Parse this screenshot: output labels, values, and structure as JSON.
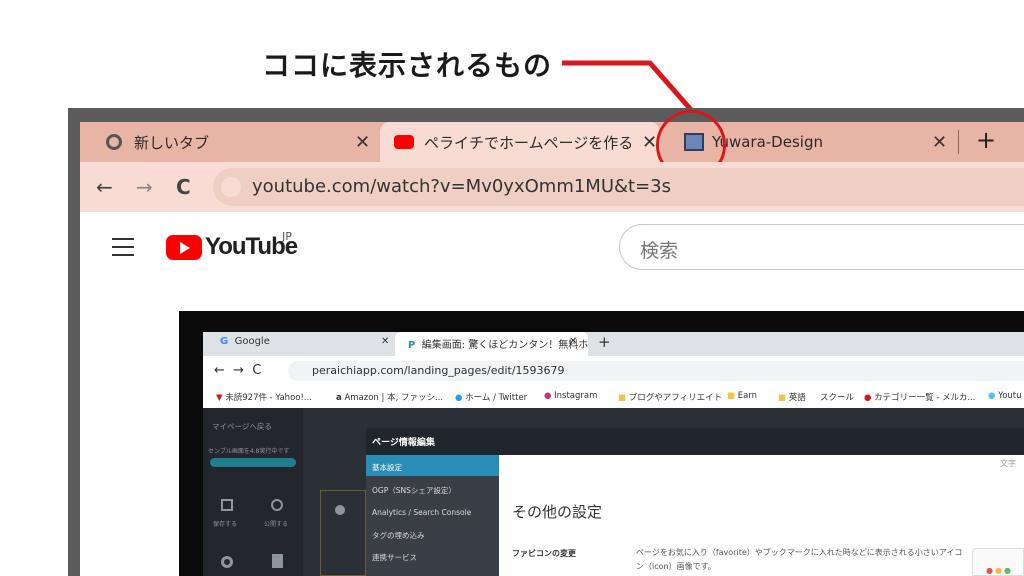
{
  "callout": {
    "text": "ココに表示されるもの",
    "color": "#d8161b"
  },
  "browser": {
    "tabs": [
      {
        "label": "新しいタブ",
        "icon": "chrome-icon",
        "close": "✕"
      },
      {
        "label": "ペライチでホームページを作る方法を初",
        "icon": "youtube-icon",
        "close": "✕"
      },
      {
        "label": "Yuwara-Design",
        "icon": "favicon-icon",
        "close": "✕"
      }
    ],
    "new_tab": "+",
    "url": "youtube.com/watch?v=Mv0yxOmm1MU&t=3s",
    "back": "←",
    "forward": "→",
    "reload": "C"
  },
  "youtube": {
    "logo_text": "YouTube",
    "region": "JP",
    "search_placeholder": "検索"
  },
  "video": {
    "tabs": [
      {
        "label": "Google",
        "close": "✕"
      },
      {
        "label": "編集画面: 驚くほどカンタン！無料ホ",
        "close": "✕"
      }
    ],
    "new_tab": "+",
    "url": "peraichiapp.com/landing_pages/edit/1593679",
    "bookmarks": [
      "未読927件 - Yahoo!...",
      "Amazon | 本, ファッシ...",
      "ホーム / Twitter",
      "Instagram",
      "ブログやアフィリエイト",
      "Earn",
      "英語",
      "スクール",
      "カテゴリー一覧 - メルカ...",
      "Youtu"
    ],
    "sidebar": [
      "マイページへ戻る",
      "センブル画面を4.8実行中です",
      "保存する",
      "公開する"
    ],
    "dialog_title": "ページ情報編集",
    "menu": [
      "基本設定",
      "OGP（SNSシェア設定）",
      "Analytics / Search Console",
      "タグの埋め込み",
      "連携サービス"
    ],
    "heading": "その他の設定",
    "label": "ファビコンの変更",
    "description": "ページをお気に入り（favorite）やブックマークに入れた時などに表示される小さいアイコン（icon）画像です。",
    "ghost_text": "文字"
  }
}
